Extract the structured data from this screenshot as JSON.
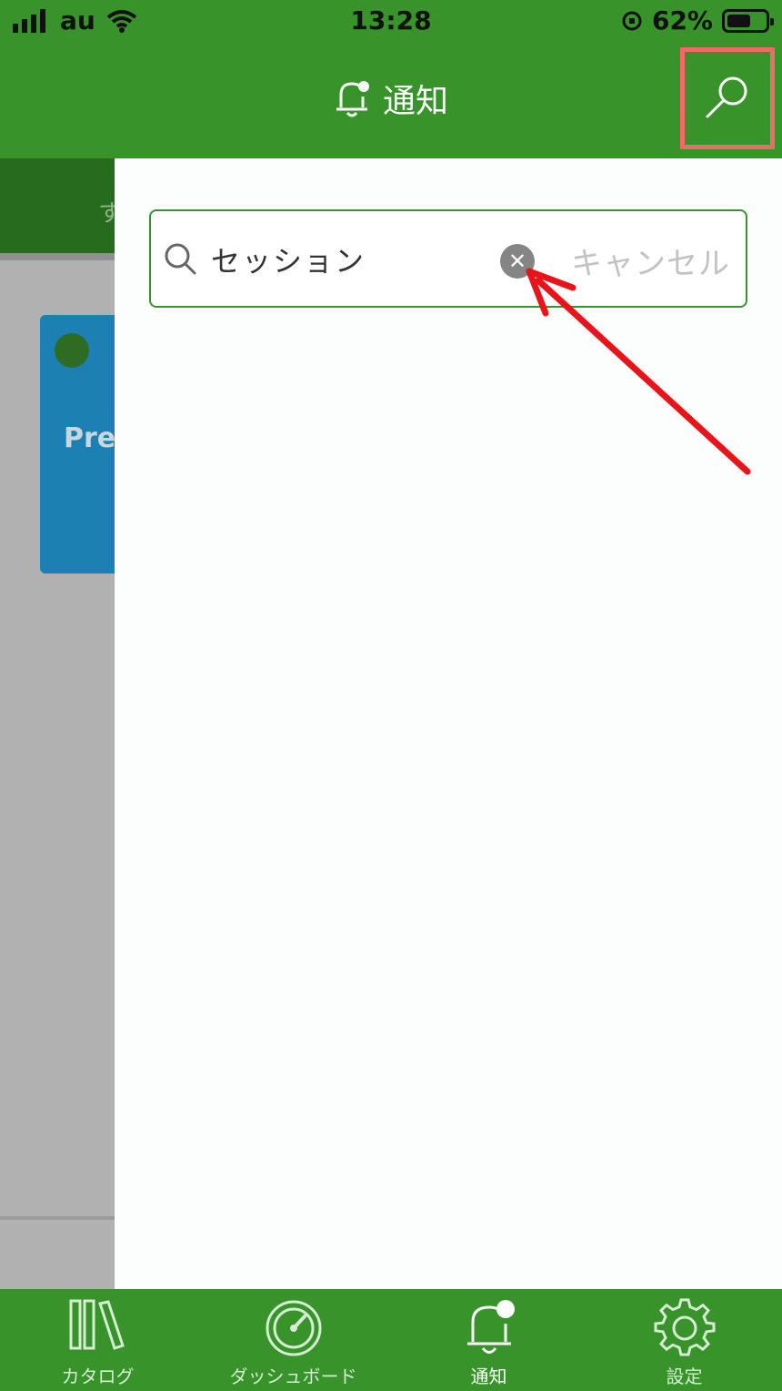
{
  "status_bar": {
    "carrier": "au",
    "time": "13:28",
    "battery": "62%",
    "battery_level": 0.62
  },
  "header": {
    "title": "通知",
    "icon": "bell-icon",
    "search_icon": "search-icon"
  },
  "background": {
    "tab_fragment": "す",
    "card_text": "Pre"
  },
  "search": {
    "query": "セッション",
    "clear_icon": "clear-icon",
    "cancel_label": "キャンセル"
  },
  "tabbar": {
    "items": [
      {
        "label": "カタログ",
        "icon": "catalog-icon"
      },
      {
        "label": "ダッシュボード",
        "icon": "dashboard-icon"
      },
      {
        "label": "通知",
        "icon": "bell-icon",
        "active": true
      },
      {
        "label": "設定",
        "icon": "gear-icon"
      }
    ]
  },
  "colors": {
    "brand_green": "#37932a",
    "highlight_box": "#f06a6a",
    "annotation_arrow": "#e8141a"
  }
}
